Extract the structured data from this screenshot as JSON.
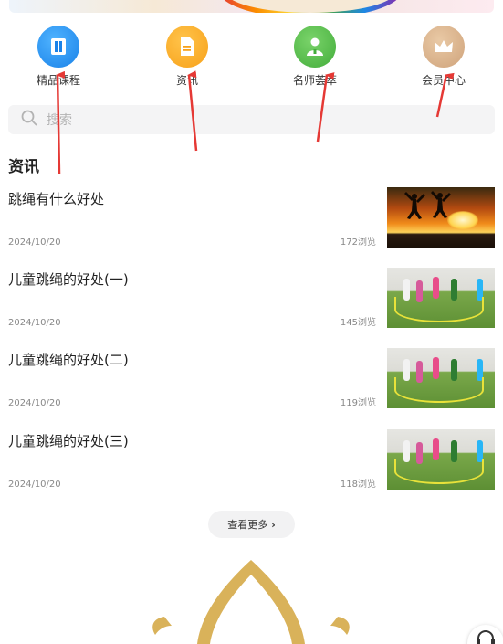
{
  "nav": {
    "items": [
      {
        "label": "精品课程",
        "icon": "book-icon"
      },
      {
        "label": "资讯",
        "icon": "document-icon"
      },
      {
        "label": "名师荟萃",
        "icon": "teacher-icon"
      },
      {
        "label": "会员中心",
        "icon": "crown-icon"
      }
    ]
  },
  "search": {
    "placeholder": "搜索"
  },
  "section": {
    "title": "资讯"
  },
  "articles": [
    {
      "title": "跳绳有什么好处",
      "date": "2024/10/20",
      "views": "172浏览"
    },
    {
      "title": "儿童跳绳的好处(一)",
      "date": "2024/10/20",
      "views": "145浏览"
    },
    {
      "title": "儿童跳绳的好处(二)",
      "date": "2024/10/20",
      "views": "119浏览"
    },
    {
      "title": "儿童跳绳的好处(三)",
      "date": "2024/10/20",
      "views": "118浏览"
    }
  ],
  "more": {
    "label": "查看更多"
  },
  "colors": {
    "blue": "#1a82e8",
    "orange": "#f7a11a",
    "green": "#43ad3b",
    "tan": "#cfa37b",
    "arrow": "#e53935",
    "gold": "#d9b25a"
  }
}
